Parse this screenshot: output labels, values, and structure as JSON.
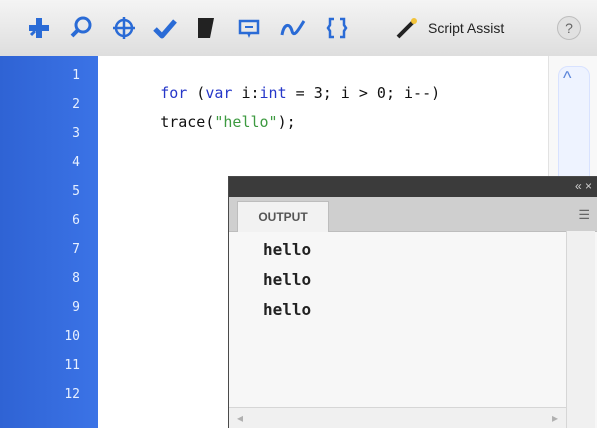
{
  "toolbar": {
    "icons": [
      "add-statement-icon",
      "find-icon",
      "target-icon",
      "check-syntax-icon",
      "format-code-icon",
      "show-code-hint-icon",
      "debug-options-icon",
      "collapse-braces-icon"
    ],
    "script_assist_label": "Script Assist",
    "help_label": "?"
  },
  "editor": {
    "line_numbers": [
      "1",
      "2",
      "3",
      "4",
      "5",
      "6",
      "7",
      "8",
      "9",
      "10",
      "11",
      "12"
    ],
    "code_lines": [
      {
        "pre": "",
        "kw1": "for",
        "mid1": " (",
        "kw2": "var",
        "mid2": " i:",
        "kw3": "int",
        "rest": " = 3; i > 0; i--)"
      },
      {
        "pre": "trace(",
        "str": "\"hello\"",
        "post": ");"
      }
    ]
  },
  "output_panel": {
    "tab_label": "OUTPUT",
    "lines": [
      "hello",
      "hello",
      "hello"
    ]
  },
  "colors": {
    "gutter": "#3b73e6",
    "keyword": "#2637c9",
    "string": "#3d9a40"
  }
}
